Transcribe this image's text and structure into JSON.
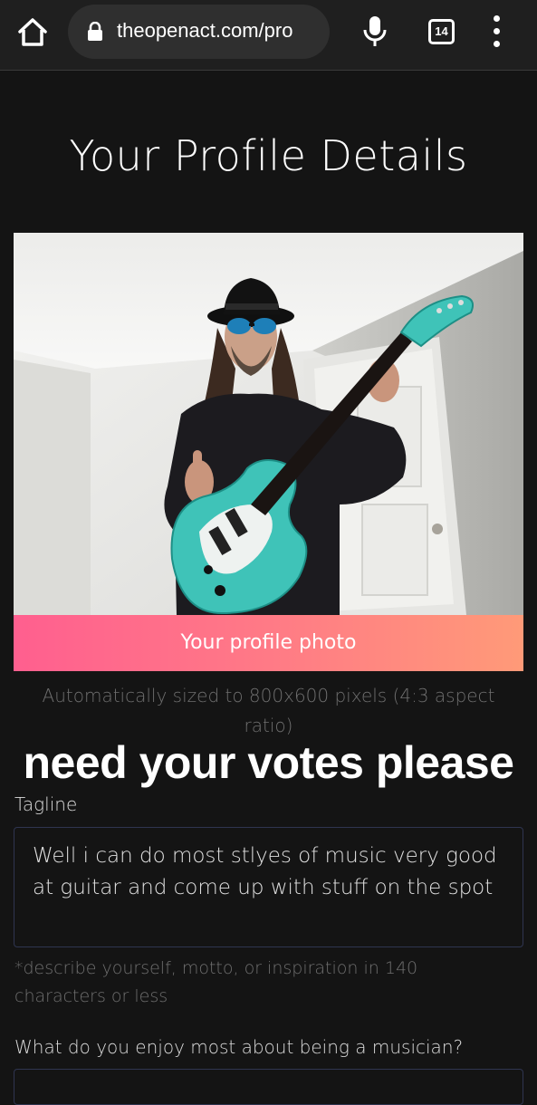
{
  "browser": {
    "url": "theopenact.com/pro",
    "tab_count": "14"
  },
  "page": {
    "title": "Your Profile Details",
    "photo_button": "Your profile photo",
    "photo_hint": "Automatically sized to 800x600 pixels (4:3 aspect ratio)",
    "overlay_caption": "need your votes please"
  },
  "form": {
    "tagline_label": "Tagline",
    "tagline_value": "Well i can do most stlyes of music very good at guitar and come up with stuff on the spot",
    "tagline_hint": "*describe yourself, motto, or inspiration in 140 characters or less",
    "enjoy_label": "What do you enjoy most about being a musician?"
  }
}
